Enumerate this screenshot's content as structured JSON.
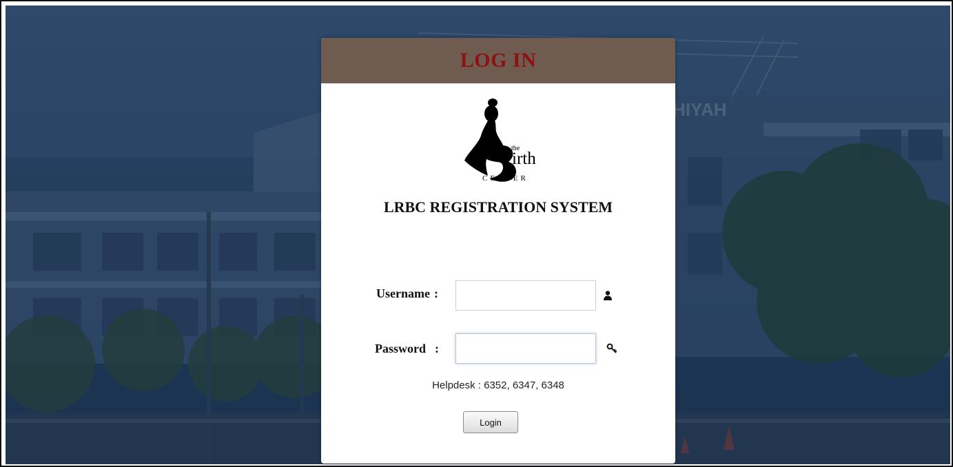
{
  "login_panel": {
    "title": "LOG IN",
    "logo": {
      "the_text": "the",
      "irth_text": "irth",
      "center_text": "CENTER"
    },
    "system_title": "LRBC REGISTRATION SYSTEM",
    "username": {
      "label": "Username",
      "colon": ":",
      "value": "",
      "icon": "user-icon"
    },
    "password": {
      "label": "Password",
      "colon": ":",
      "value": "",
      "icon": "key-icon"
    },
    "helpdesk": "Helpdesk : 6352, 6347, 6348",
    "login_button": "Login"
  },
  "background": {
    "sign_text": "HIYAH"
  },
  "colors": {
    "header_bg": "#6f5b4f",
    "title_color": "#8c1212",
    "background_tint": "#2c4767"
  }
}
